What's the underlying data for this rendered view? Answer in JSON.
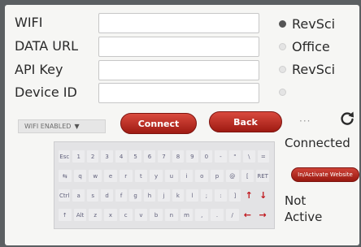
{
  "form": {
    "fields": [
      {
        "label": "WIFI",
        "value": ""
      },
      {
        "label": "DATA URL",
        "value": ""
      },
      {
        "label": "API Key",
        "value": ""
      },
      {
        "label": "Device ID",
        "value": ""
      }
    ]
  },
  "radios": [
    {
      "label": "RevSci",
      "selected": true
    },
    {
      "label": "Office",
      "selected": false
    },
    {
      "label": "RevSci",
      "selected": false
    },
    {
      "label": "",
      "selected": false
    }
  ],
  "controls": {
    "wifi_select": "WIFI ENABLED",
    "connect_label": "Connect",
    "back_label": "Back",
    "dots": "···"
  },
  "status": {
    "connection": "Connected",
    "toggle_label": "In/Activate Website",
    "website_line1": "Not",
    "website_line2": "Active"
  },
  "keyboard": {
    "rows": [
      [
        "Esc",
        "1",
        "2",
        "3",
        "4",
        "5",
        "6",
        "7",
        "8",
        "9",
        "0",
        "-",
        "\"",
        "\\",
        "="
      ],
      [
        "⇆",
        "q",
        "w",
        "e",
        "r",
        "t",
        "y",
        "u",
        "i",
        "o",
        "p",
        "@",
        "[",
        "RET"
      ],
      [
        "Ctrl",
        "a",
        "s",
        "d",
        "f",
        "g",
        "h",
        "j",
        "k",
        "l",
        ";",
        ":",
        "]",
        "↑",
        "↓"
      ],
      [
        "↑",
        "Alt",
        "z",
        "x",
        "c",
        "v",
        "b",
        "n",
        "m",
        ",",
        ".",
        "/",
        "←",
        "→"
      ]
    ]
  },
  "colors": {
    "button_red": "#b8261c",
    "screen_bg": "#f6f6f4",
    "bezel": "#5b5f62"
  }
}
